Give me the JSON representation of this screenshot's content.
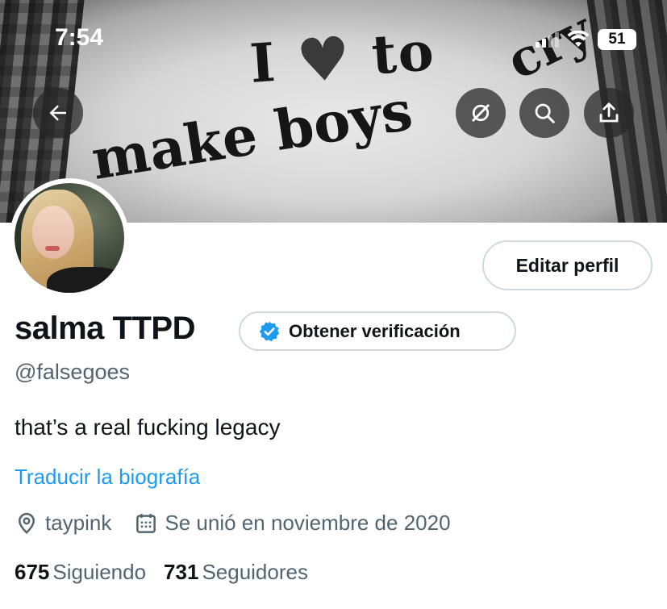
{
  "status_bar": {
    "time": "7:54",
    "battery": "51"
  },
  "banner": {
    "shirt_text_line1_a": "I",
    "shirt_text_line1_b": "to",
    "shirt_text_line2": "make boys",
    "shirt_text_line2b": "cry"
  },
  "header_icons": [
    "back-arrow-icon",
    "grok-icon",
    "search-icon",
    "share-icon"
  ],
  "profile": {
    "edit_button": "Editar perfil",
    "name": "salma TTPD",
    "verify_button": "Obtener verificación",
    "handle": "@falsegoes",
    "bio": "that’s a real fucking legacy",
    "translate_link": "Traducir la biografía",
    "location": "taypink",
    "joined": "Se unió en noviembre de 2020",
    "following_count": "675",
    "following_label": "Siguiendo",
    "followers_count": "731",
    "followers_label": "Seguidores"
  },
  "colors": {
    "link": "#1d9bf0",
    "secondary_text": "#536471",
    "border": "#cfd9de",
    "verified_badge": "#1d9bf0"
  }
}
